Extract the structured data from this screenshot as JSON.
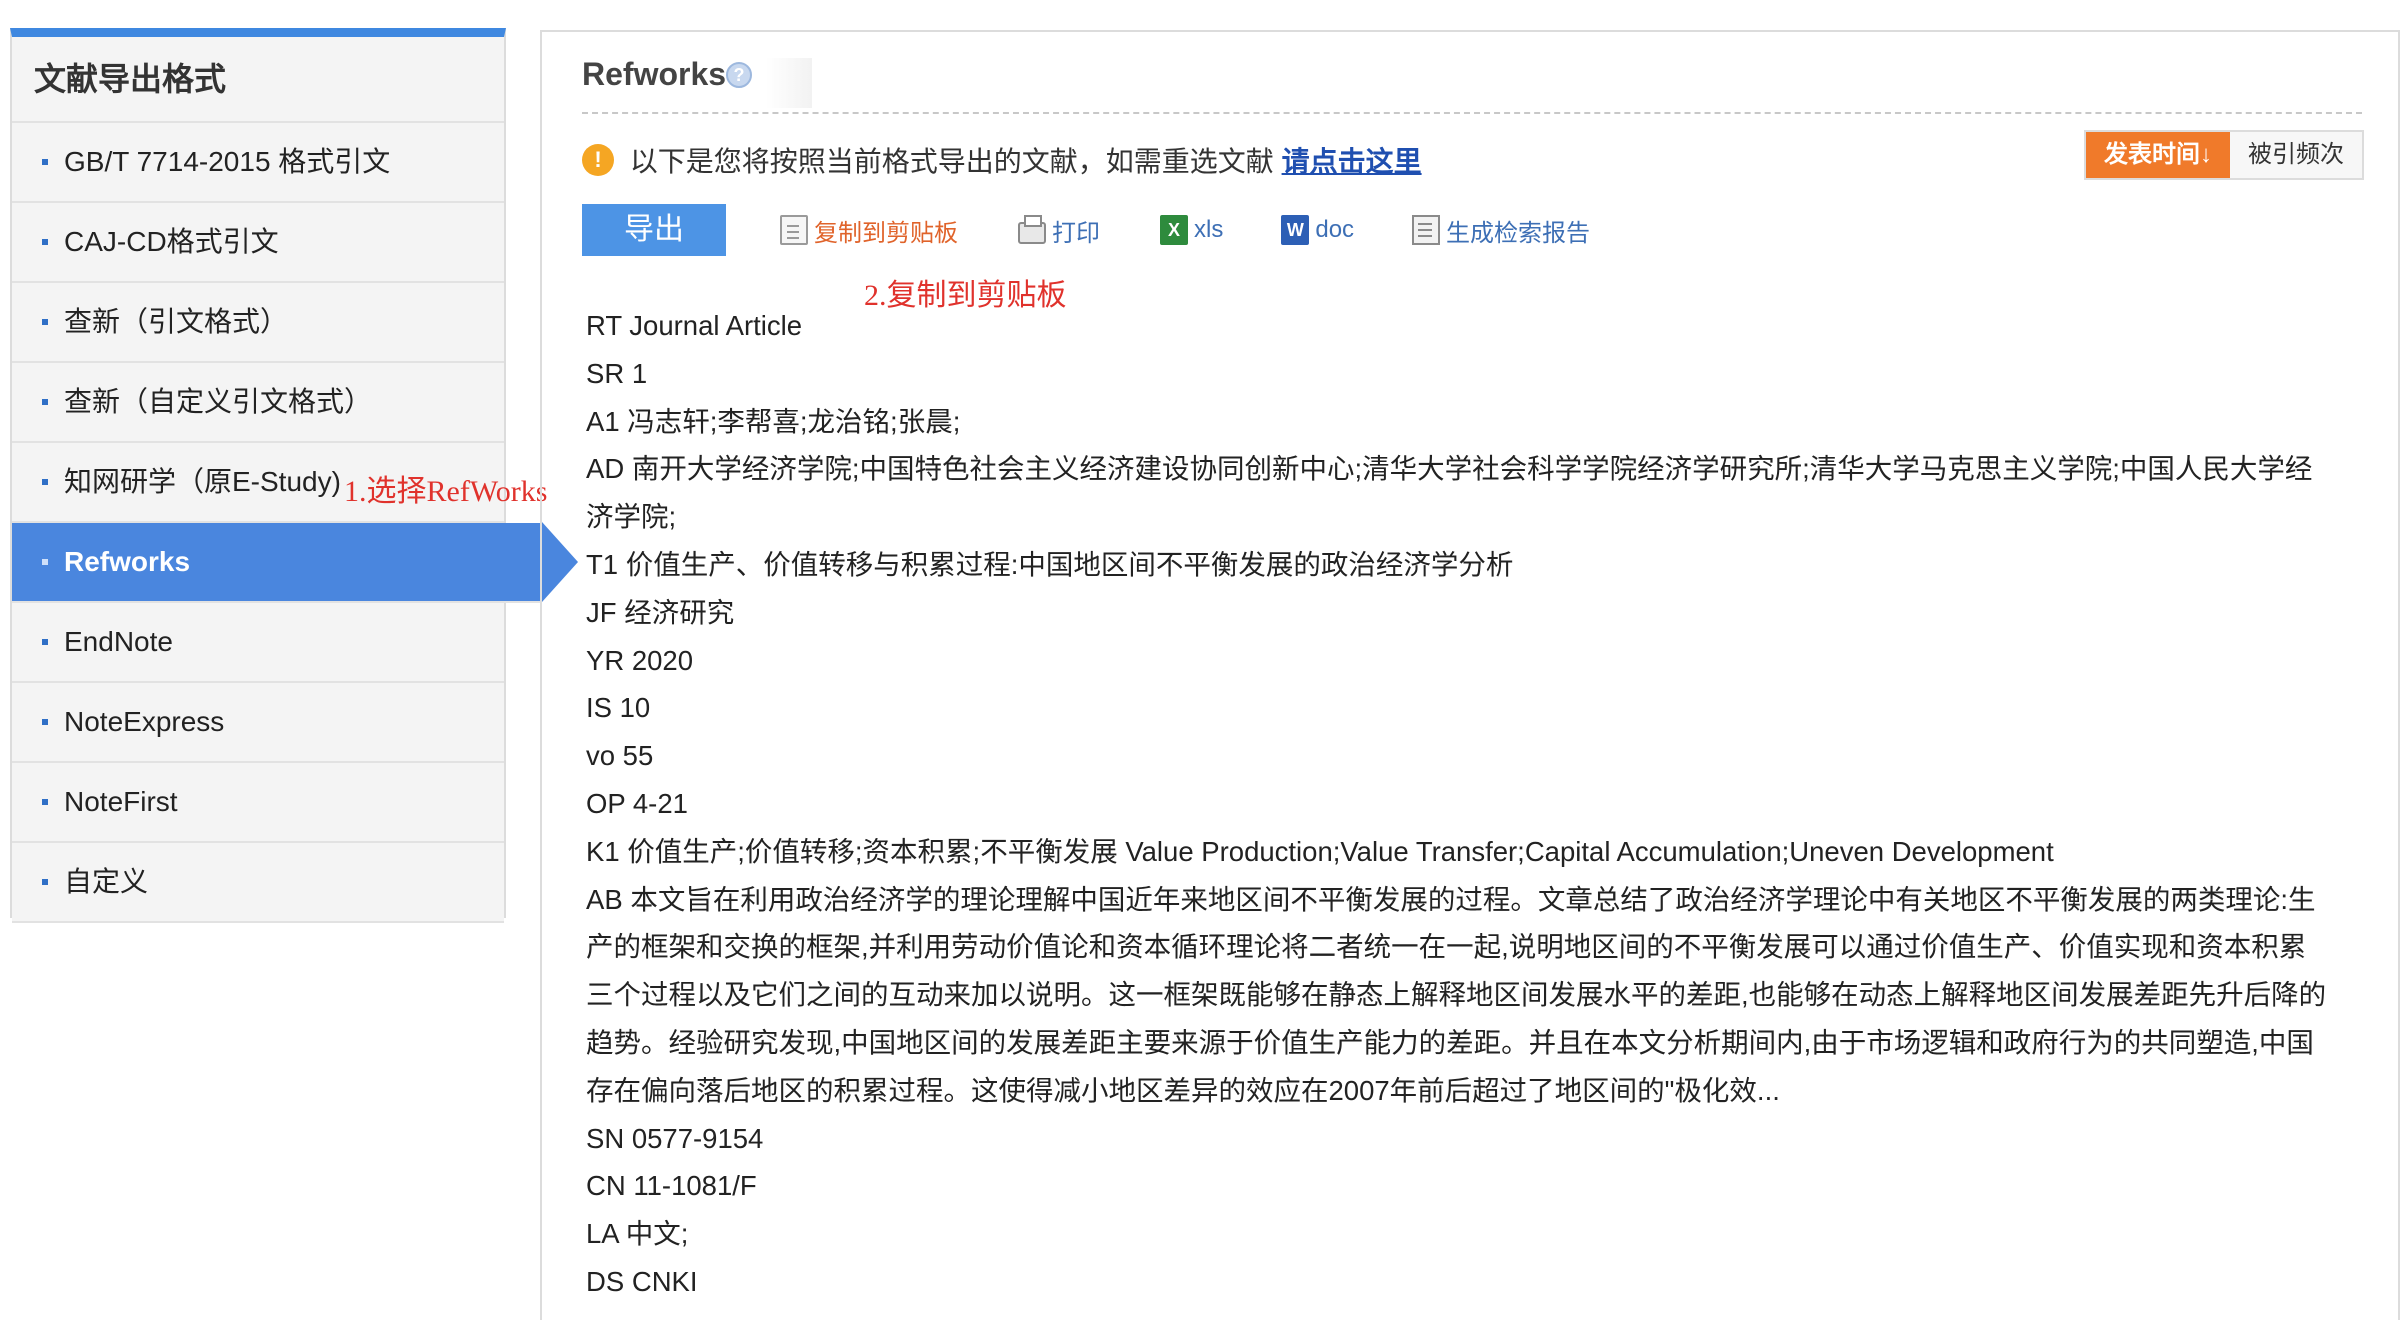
{
  "sidebar": {
    "title": "文献导出格式",
    "items": [
      {
        "label": "GB/T 7714-2015 格式引文"
      },
      {
        "label": "CAJ-CD格式引文"
      },
      {
        "label": "查新（引文格式）"
      },
      {
        "label": "查新（自定义引文格式）"
      },
      {
        "label": "知网研学（原E-Study)"
      },
      {
        "label": "Refworks"
      },
      {
        "label": "EndNote"
      },
      {
        "label": "NoteExpress"
      },
      {
        "label": "NoteFirst"
      },
      {
        "label": "自定义"
      }
    ],
    "active_item": "Refworks"
  },
  "annotations": {
    "step1": "1.选择RefWorks",
    "step2": "2.复制到剪贴板"
  },
  "main": {
    "title": "Refworks",
    "help_icon": "?",
    "notice": {
      "icon": "!",
      "text": "以下是您将按照当前格式导出的文献，如需重选文献",
      "link": "请点击这里"
    },
    "sort": {
      "publish_time": "发表时间",
      "citations": "被引频次"
    },
    "toolbar": {
      "export": "导出",
      "copy": "复制到剪贴板",
      "print": "打印",
      "xls": "xls",
      "doc": "doc",
      "report": "生成检索报告"
    },
    "record_lines": [
      "RT Journal Article",
      "SR 1",
      "A1 冯志轩;李帮喜;龙治铭;张晨;",
      "AD 南开大学经济学院;中国特色社会主义经济建设协同创新中心;清华大学社会科学学院经济学研究所;清华大学马克思主义学院;中国人民大学经",
      "济学院;",
      "T1 价值生产、价值转移与积累过程:中国地区间不平衡发展的政治经济学分析",
      "JF 经济研究",
      "YR 2020",
      "IS 10",
      "vo 55",
      "OP 4-21",
      "K1 价值生产;价值转移;资本积累;不平衡发展 Value Production;Value Transfer;Capital Accumulation;Uneven Development",
      "AB 本文旨在利用政治经济学的理论理解中国近年来地区间不平衡发展的过程。文章总结了政治经济学理论中有关地区不平衡发展的两类理论:生",
      "产的框架和交换的框架,并利用劳动价值论和资本循环理论将二者统一在一起,说明地区间的不平衡发展可以通过价值生产、价值实现和资本积累",
      "三个过程以及它们之间的互动来加以说明。这一框架既能够在静态上解释地区间发展水平的差距,也能够在动态上解释地区间发展差距先升后降的",
      "趋势。经验研究发现,中国地区间的发展差距主要来源于价值生产能力的差距。并且在本文分析期间内,由于市场逻辑和政府行为的共同塑造,中国",
      "存在偏向落后地区的积累过程。这使得减小地区差异的效应在2007年前后超过了地区间的\"极化效...",
      "SN 0577-9154",
      "CN 11-1081/F",
      "LA 中文;",
      "DS CNKI"
    ]
  },
  "colors": {
    "accent_blue": "#4a86de",
    "sidebar_top_bar": "#3f88e0",
    "sort_active": "#f07a2a",
    "annotation_red": "#e0322c",
    "link_blue": "#1f4fb0"
  }
}
